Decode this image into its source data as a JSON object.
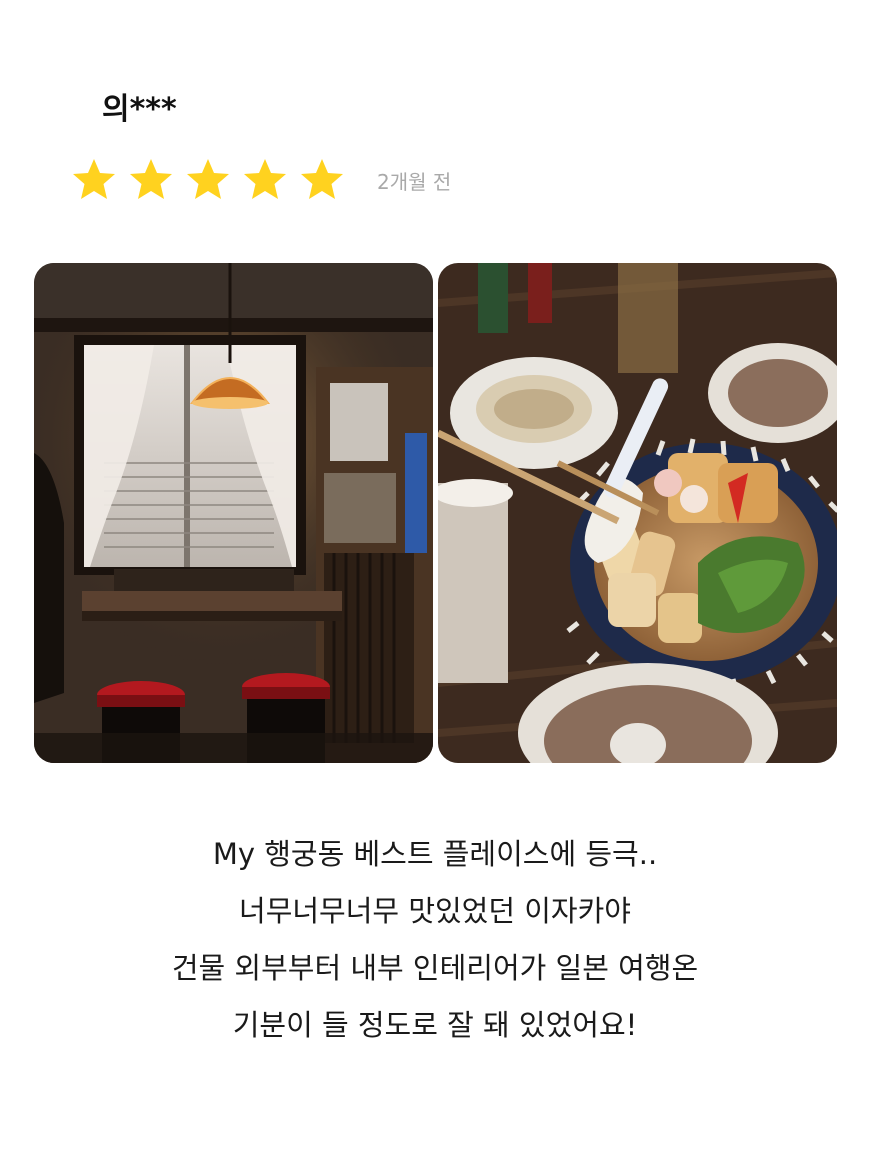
{
  "review": {
    "reviewer_name": "의***",
    "rating": 5,
    "max_rating": 5,
    "date": "2개월 전",
    "star_color": "#ffd21f",
    "photos": [
      {
        "name": "review-photo-interior"
      },
      {
        "name": "review-photo-food"
      }
    ],
    "text_lines": [
      "My 행궁동 베스트 플레이스에 등극..",
      "너무너무너무 맛있었던 이자카야",
      "건물 외부부터 내부 인테리어가 일본 여행온",
      "기분이 들 정도로 잘 돼 있었어요!"
    ]
  }
}
